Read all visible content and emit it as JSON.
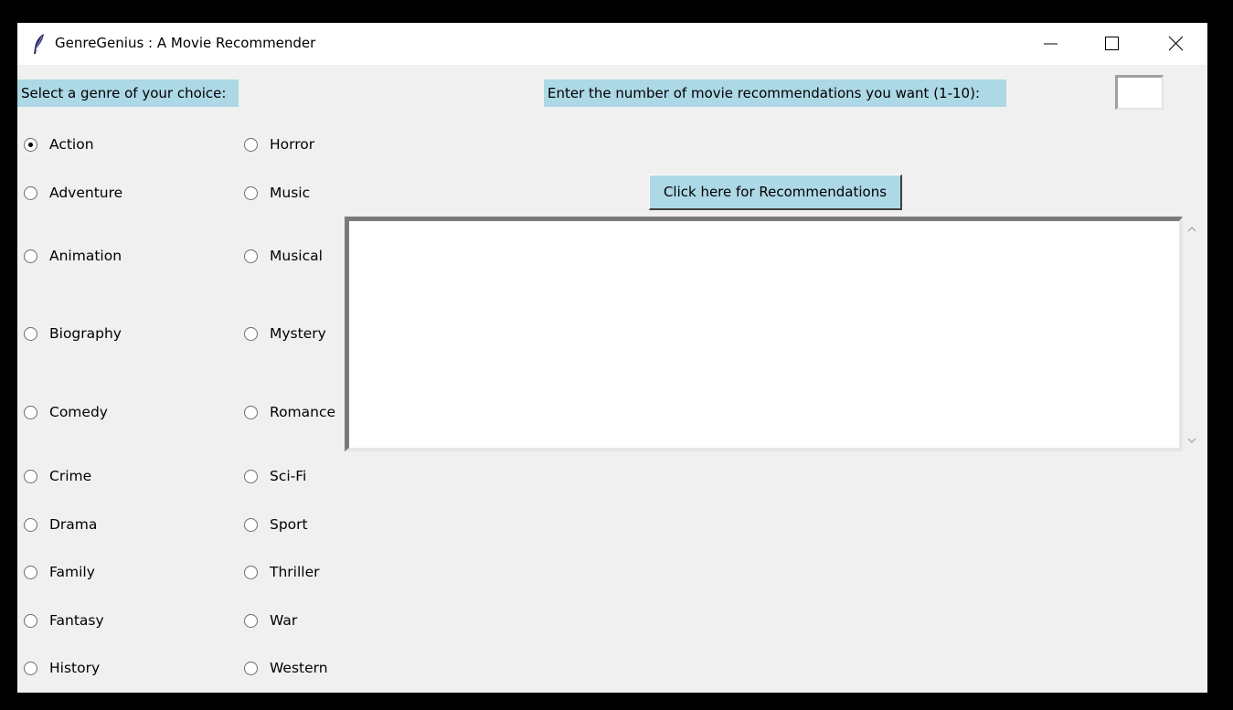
{
  "window": {
    "title": "GenreGenius : A Movie Recommender",
    "icon": "feather-icon",
    "controls": [
      "minimize-icon",
      "maximize-icon",
      "close-icon"
    ]
  },
  "labels": {
    "genre_prompt": "Select a genre of your choice:",
    "count_prompt": "Enter the number of movie recommendations you want (1-10):"
  },
  "count_input": {
    "value": ""
  },
  "recommend_button": {
    "label": "Click here for Recommendations"
  },
  "genres": {
    "selected": "Action",
    "items": [
      "Action",
      "Adventure",
      "Animation",
      "Biography",
      "Comedy",
      "Crime",
      "Drama",
      "Family",
      "Fantasy",
      "History",
      "Horror",
      "Music",
      "Musical",
      "Mystery",
      "Romance",
      "Sci-Fi",
      "Sport",
      "Thriller",
      "War",
      "Western"
    ]
  },
  "output": {
    "text": ""
  },
  "colors": {
    "label_bg": "#add8e6",
    "window_bg": "#f0f0f0",
    "outer_bg": "#000000"
  }
}
